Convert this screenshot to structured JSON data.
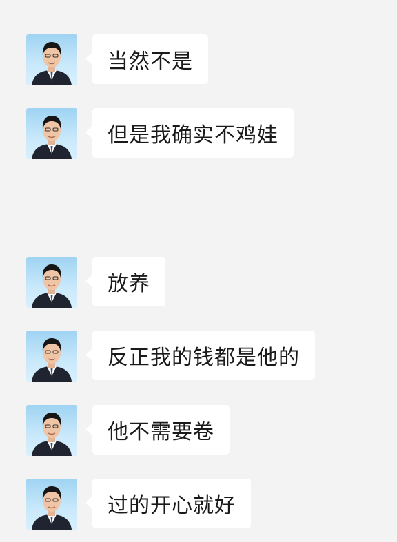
{
  "chat": {
    "messages": [
      {
        "text": "当然不是",
        "avatar": "man-in-suit-avatar"
      },
      {
        "text": "但是我确实不鸡娃",
        "avatar": "man-in-suit-avatar"
      },
      {
        "text": "放养",
        "avatar": "man-in-suit-avatar"
      },
      {
        "text": "反正我的钱都是他的",
        "avatar": "man-in-suit-avatar"
      },
      {
        "text": "他不需要卷",
        "avatar": "man-in-suit-avatar"
      },
      {
        "text": "过的开心就好",
        "avatar": "man-in-suit-avatar"
      }
    ]
  },
  "colors": {
    "background": "#f3f3f3",
    "bubble": "#ffffff",
    "text": "#1a1a1a",
    "avatar_bg": "#a9d9f4"
  }
}
